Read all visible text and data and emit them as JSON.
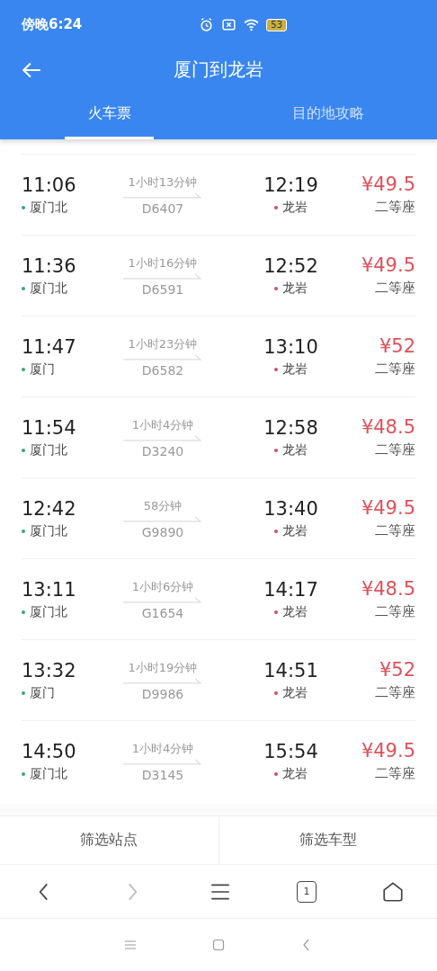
{
  "status_bar": {
    "time": "傍晚6:24",
    "battery": "53"
  },
  "header": {
    "title": "厦门到龙岩"
  },
  "tabs": [
    {
      "label": "火车票",
      "selected": true
    },
    {
      "label": "目的地攻略",
      "selected": false
    }
  ],
  "trains": [
    {
      "depart_time": "11:06",
      "depart_station": "厦门北",
      "duration": "1小时13分钟",
      "train_no": "D6407",
      "arrive_time": "12:19",
      "arrive_station": "龙岩",
      "price": "¥49.5",
      "seat": "二等座"
    },
    {
      "depart_time": "11:36",
      "depart_station": "厦门北",
      "duration": "1小时16分钟",
      "train_no": "D6591",
      "arrive_time": "12:52",
      "arrive_station": "龙岩",
      "price": "¥49.5",
      "seat": "二等座"
    },
    {
      "depart_time": "11:47",
      "depart_station": "厦门",
      "duration": "1小时23分钟",
      "train_no": "D6582",
      "arrive_time": "13:10",
      "arrive_station": "龙岩",
      "price": "¥52",
      "seat": "二等座"
    },
    {
      "depart_time": "11:54",
      "depart_station": "厦门北",
      "duration": "1小时4分钟",
      "train_no": "D3240",
      "arrive_time": "12:58",
      "arrive_station": "龙岩",
      "price": "¥48.5",
      "seat": "二等座"
    },
    {
      "depart_time": "12:42",
      "depart_station": "厦门北",
      "duration": "58分钟",
      "train_no": "G9890",
      "arrive_time": "13:40",
      "arrive_station": "龙岩",
      "price": "¥49.5",
      "seat": "二等座"
    },
    {
      "depart_time": "13:11",
      "depart_station": "厦门北",
      "duration": "1小时6分钟",
      "train_no": "G1654",
      "arrive_time": "14:17",
      "arrive_station": "龙岩",
      "price": "¥48.5",
      "seat": "二等座"
    },
    {
      "depart_time": "13:32",
      "depart_station": "厦门",
      "duration": "1小时19分钟",
      "train_no": "D9986",
      "arrive_time": "14:51",
      "arrive_station": "龙岩",
      "price": "¥52",
      "seat": "二等座"
    },
    {
      "depart_time": "14:50",
      "depart_station": "厦门北",
      "duration": "1小时4分钟",
      "train_no": "D3145",
      "arrive_time": "15:54",
      "arrive_station": "龙岩",
      "price": "¥49.5",
      "seat": "二等座"
    }
  ],
  "filters": [
    "筛选站点",
    "筛选车型"
  ],
  "browser_nav": {
    "forward_disabled": true,
    "tab_count": "1"
  }
}
